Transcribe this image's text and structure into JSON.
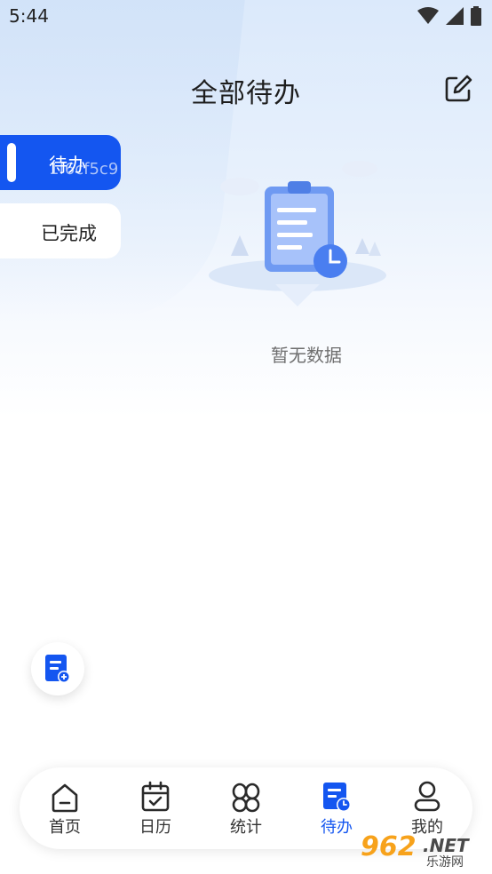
{
  "status_bar": {
    "time": "5:44"
  },
  "header": {
    "title": "全部待办"
  },
  "side_tabs": [
    {
      "label": "待办",
      "overlay": "1f6cf5c9"
    },
    {
      "label": "已完成"
    }
  ],
  "empty_state": {
    "text": "暂无数据"
  },
  "bottom_nav": {
    "items": [
      {
        "label": "首页",
        "icon": "home-icon"
      },
      {
        "label": "日历",
        "icon": "calendar-icon"
      },
      {
        "label": "统计",
        "icon": "stats-icon"
      },
      {
        "label": "待办",
        "icon": "todo-icon",
        "active": true
      },
      {
        "label": "我的",
        "icon": "profile-icon"
      }
    ]
  },
  "watermark": {
    "number": "962",
    "net": ".NET",
    "cn": "乐游网"
  },
  "colors": {
    "accent": "#1456f0",
    "background_top": "#dbe9fb"
  }
}
